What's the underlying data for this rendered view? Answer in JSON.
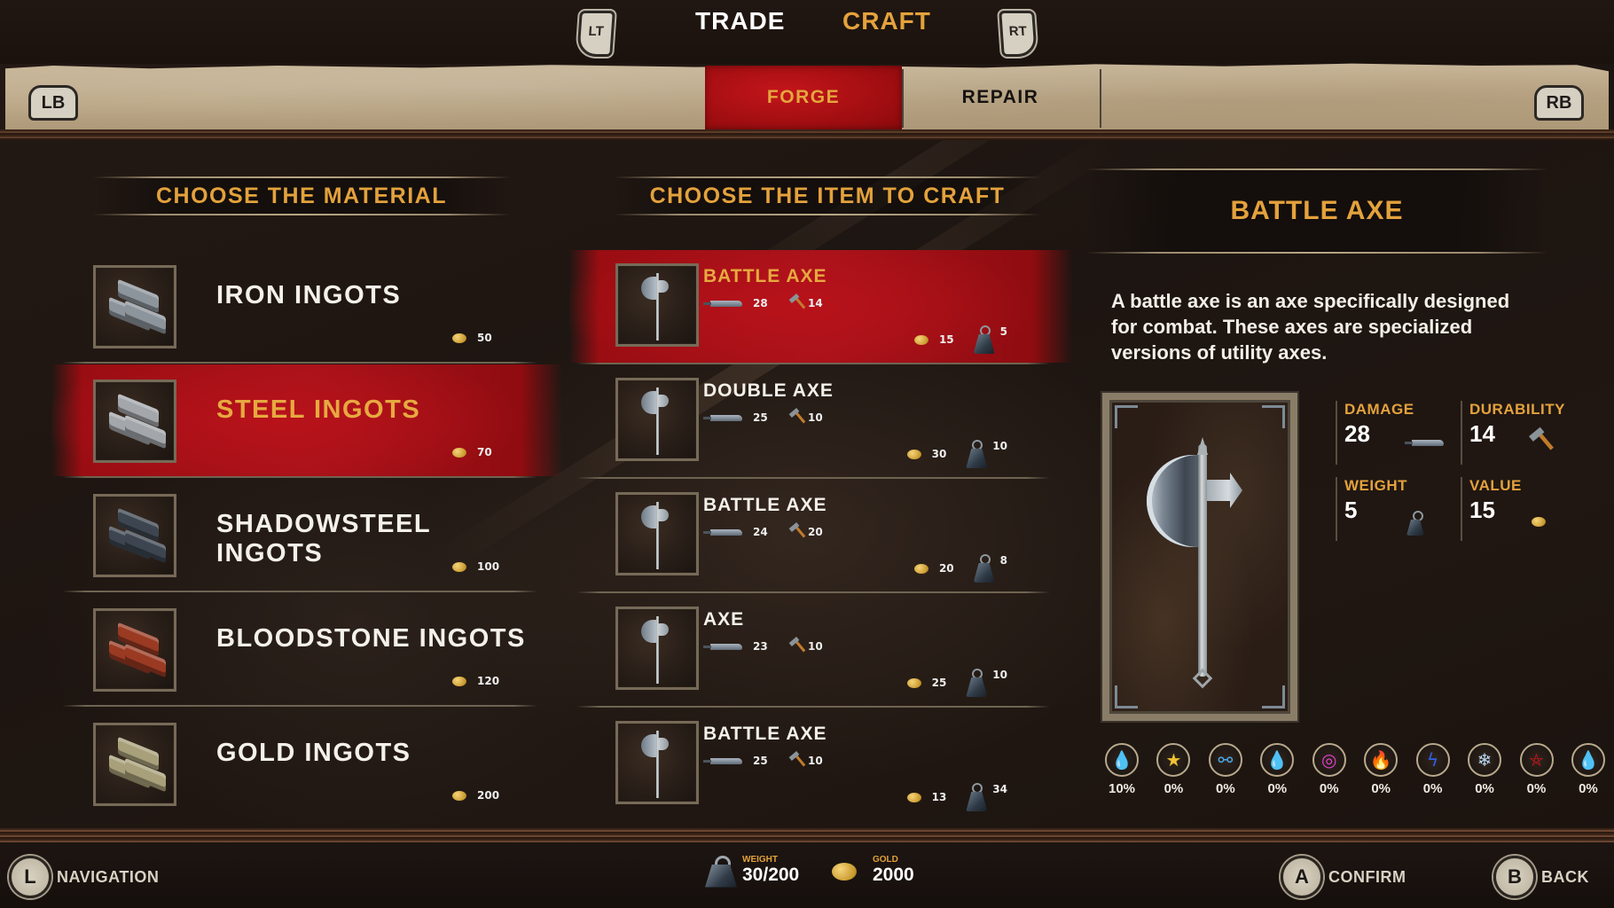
{
  "top_tabs": {
    "left_trigger": "LT",
    "right_trigger": "RT",
    "tabs": [
      {
        "label": "TRADE",
        "active": false
      },
      {
        "label": "CRAFT",
        "active": true
      }
    ]
  },
  "sub_tabs": {
    "left_bumper": "LB",
    "right_bumper": "RB",
    "tabs": [
      {
        "label": "FORGE",
        "active": true
      },
      {
        "label": "REPAIR",
        "active": false
      }
    ]
  },
  "materials": {
    "title": "CHOOSE THE MATERIAL",
    "items": [
      {
        "name": "IRON INGOTS",
        "price": "50",
        "selected": false,
        "color": "#8c949c"
      },
      {
        "name": "STEEL INGOTS",
        "price": "70",
        "selected": true,
        "color": "#a3a7ab"
      },
      {
        "name": "SHADOWSTEEL INGOTS",
        "price": "100",
        "selected": false,
        "color": "#3d4650"
      },
      {
        "name": "BLOODSTONE INGOTS",
        "price": "120",
        "selected": false,
        "color": "#9a3a22"
      },
      {
        "name": "GOLD INGOTS",
        "price": "200",
        "selected": false,
        "color": "#a8a07a"
      }
    ]
  },
  "craft_items": {
    "title": "CHOOSE THE ITEM TO CRAFT",
    "items": [
      {
        "name": "BATTLE AXE",
        "damage": "28",
        "durability": "14",
        "price": "15",
        "weight": "5",
        "selected": true
      },
      {
        "name": "DOUBLE AXE",
        "damage": "25",
        "durability": "10",
        "price": "30",
        "weight": "10",
        "selected": false
      },
      {
        "name": "BATTLE AXE",
        "damage": "24",
        "durability": "20",
        "price": "20",
        "weight": "8",
        "selected": false
      },
      {
        "name": "AXE",
        "damage": "23",
        "durability": "10",
        "price": "25",
        "weight": "10",
        "selected": false
      },
      {
        "name": "BATTLE AXE",
        "damage": "25",
        "durability": "10",
        "price": "13",
        "weight": "34",
        "selected": false
      }
    ]
  },
  "detail": {
    "title": "BATTLE AXE",
    "description": "A battle axe is an axe specifically designed for combat. These axes are specialized versions of utility axes.",
    "stats": {
      "damage_label": "DAMAGE",
      "damage": "28",
      "durability_label": "DURABILITY",
      "durability": "14",
      "weight_label": "WEIGHT",
      "weight": "5",
      "value_label": "VALUE",
      "value": "15"
    },
    "resistances": [
      {
        "icon": "blood-drop-icon",
        "glyph": "💧",
        "color": "#d0141a",
        "value": "10%"
      },
      {
        "icon": "stun-stars-icon",
        "glyph": "★",
        "color": "#f1c232",
        "value": "0%"
      },
      {
        "icon": "bleed-chain-icon",
        "glyph": "⚯",
        "color": "#4aa8e8",
        "value": "0%"
      },
      {
        "icon": "poison-drop-icon",
        "glyph": "💧",
        "color": "#5fd62a",
        "value": "0%"
      },
      {
        "icon": "magic-orb-icon",
        "glyph": "◎",
        "color": "#e040d0",
        "value": "0%"
      },
      {
        "icon": "fire-icon",
        "glyph": "🔥",
        "color": "#f08020",
        "value": "0%"
      },
      {
        "icon": "lightning-icon",
        "glyph": "ϟ",
        "color": "#2f5fe8",
        "value": "0%"
      },
      {
        "icon": "frost-snowflake-icon",
        "glyph": "❄",
        "color": "#b7d6f0",
        "value": "0%"
      },
      {
        "icon": "pentagram-icon",
        "glyph": "⛤",
        "color": "#d0141a",
        "value": "0%"
      },
      {
        "icon": "holy-flame-icon",
        "glyph": "💧",
        "color": "#e0a030",
        "value": "0%"
      }
    ]
  },
  "footer": {
    "navigation": {
      "button": "L",
      "label": "NAVIGATION"
    },
    "weight": {
      "label": "WEIGHT",
      "value": "30/200"
    },
    "gold": {
      "label": "GOLD",
      "value": "2000"
    },
    "confirm": {
      "button": "A",
      "label": "CONFIRM"
    },
    "back": {
      "button": "B",
      "label": "BACK"
    }
  }
}
